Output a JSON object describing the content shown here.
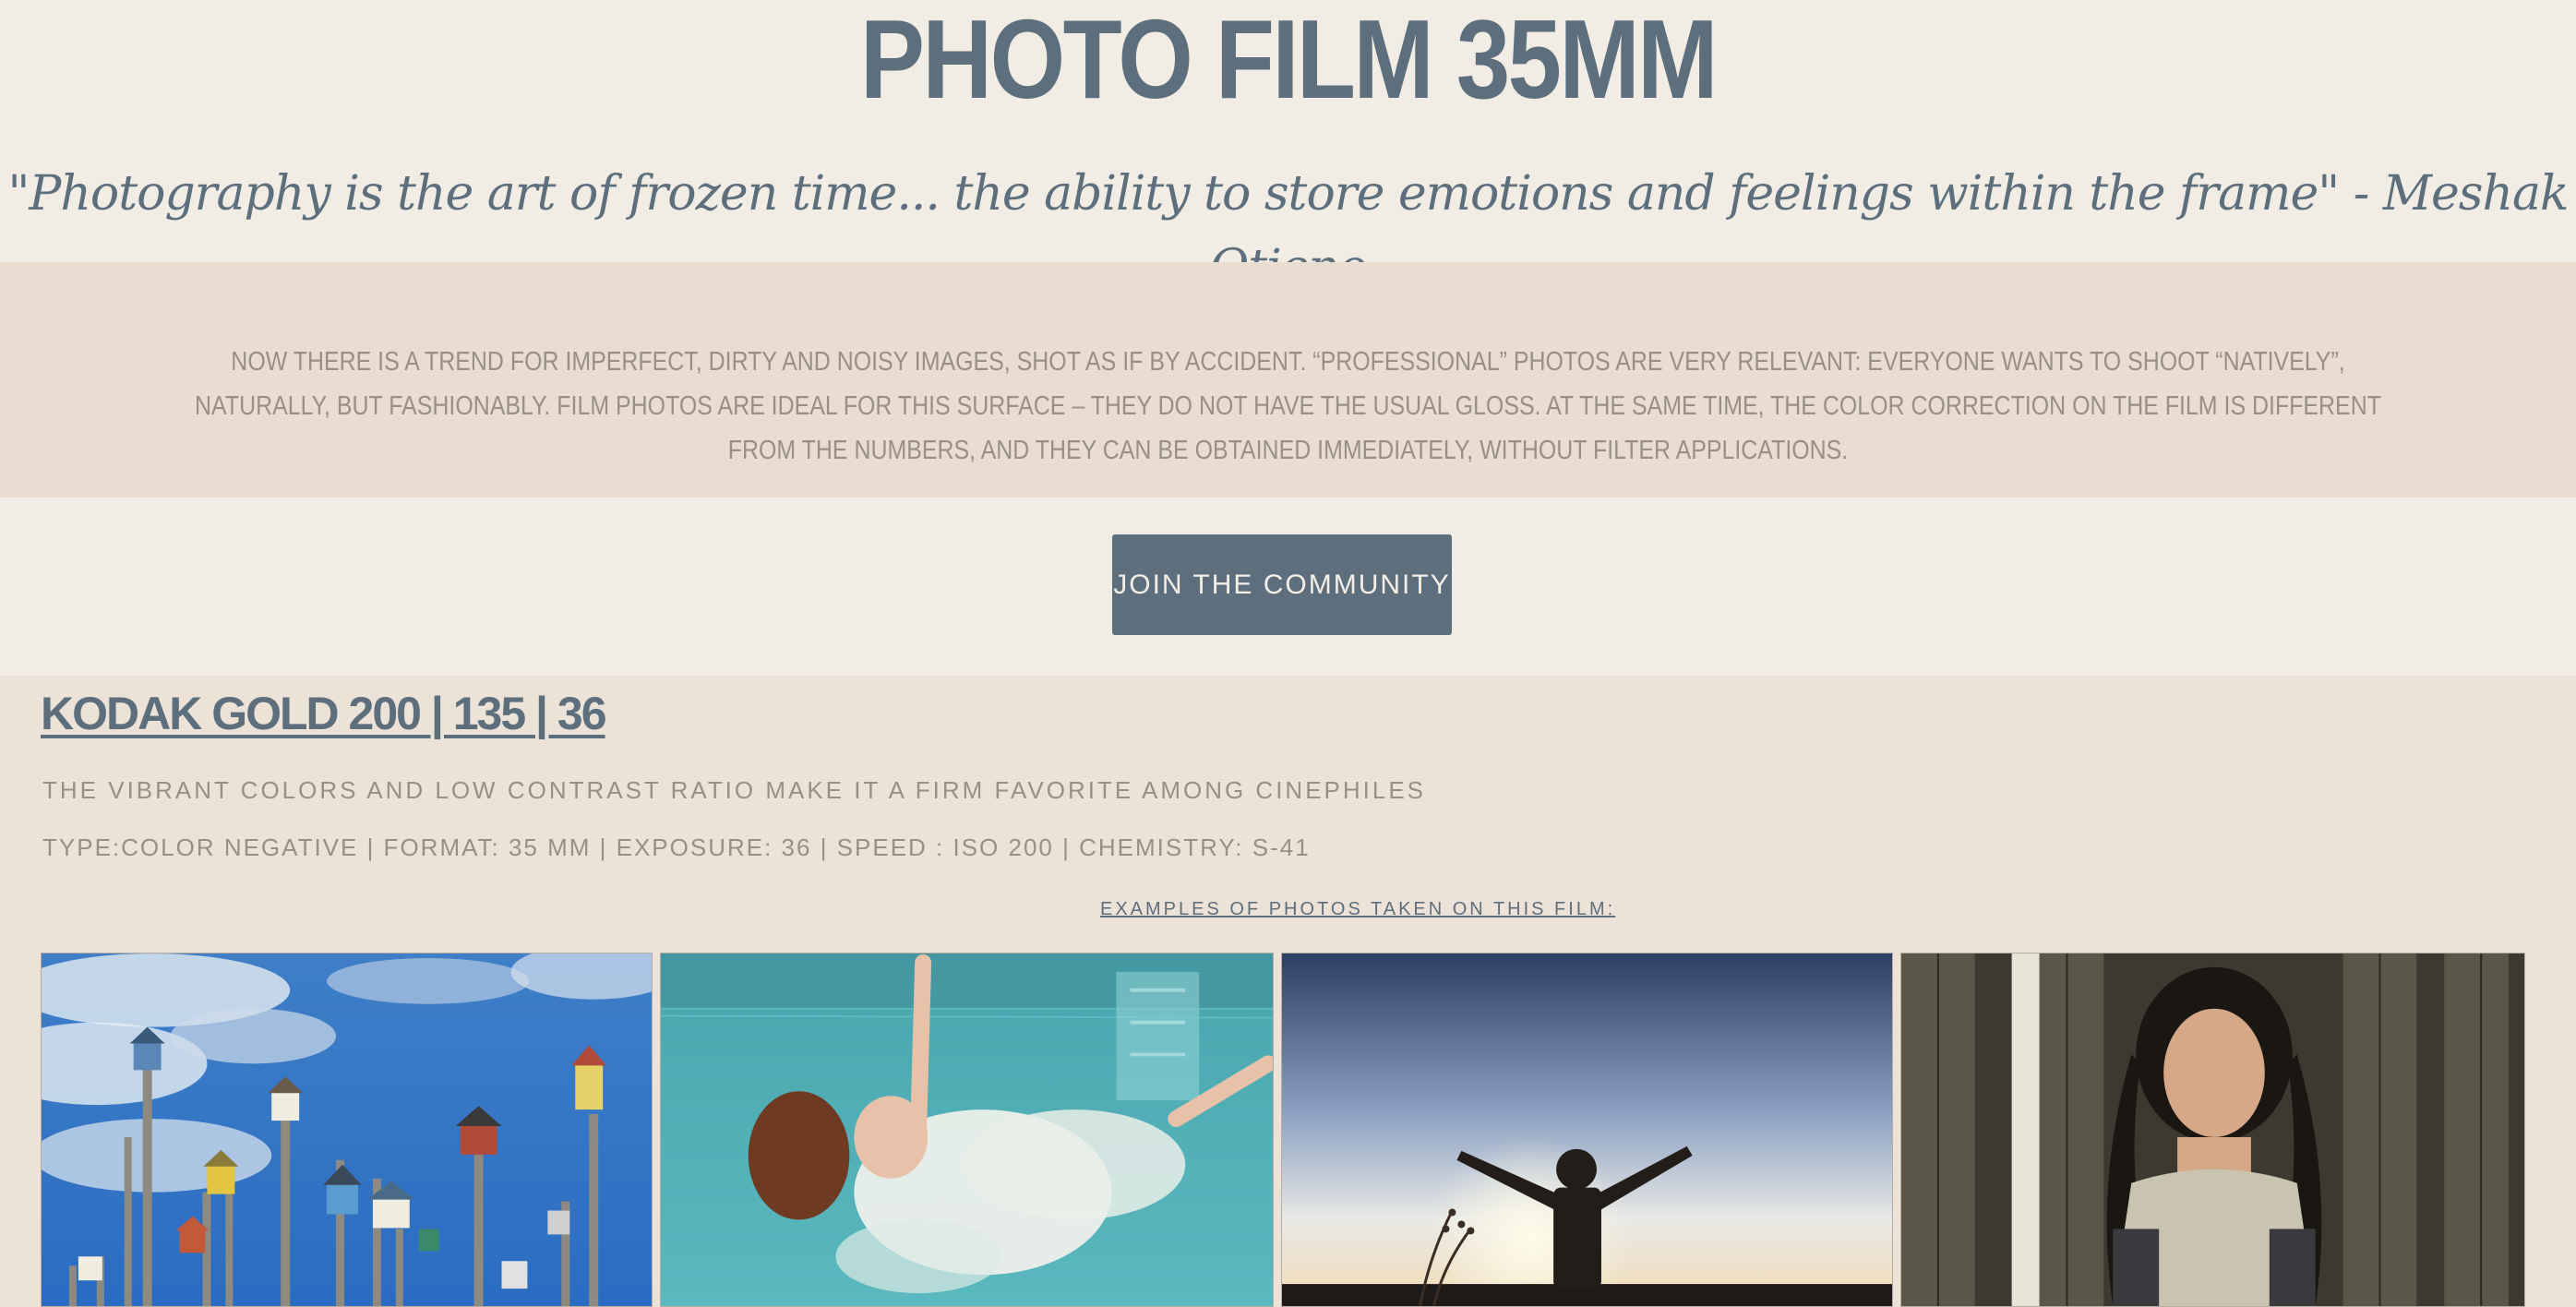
{
  "header": {
    "title": "PHOTO FILM 35MM",
    "quote": "\"Photography is the art of frozen time... the ability to store emotions and feelings within the frame\" - Meshak Otieno"
  },
  "intro": {
    "text": "Now there is a trend for imperfect, dirty and noisy images, shot as if by accident. “Professional” photos are very relevant: everyone wants to shoot “natively”, naturally, but fashionably. Film photos are ideal for this surface – they do not have the usual gloss. At the same time, the color correction on the film is different from the numbers, and they can be obtained immediately, without filter applications."
  },
  "cta": {
    "label": "JOIN THE COMMUNITY"
  },
  "film": {
    "title": "KODAK GOLD 200 | 135 | 36",
    "description": "THE VIBRANT COLORS AND LOW CONTRAST RATIO MAKE IT A FIRM FAVORITE AMONG CINEPHILES",
    "specs": "TYPE:COLOR NEGATIVE | FORMAT: 35 MM | EXPOSURE: 36 | SPEED : ISO 200 | CHEMISTRY: S-41",
    "examples_label": "EXAMPLES OF PHOTOS TAKEN ON THIS FILM:",
    "photos": [
      {
        "subject": "birdhouses-on-poles"
      },
      {
        "subject": "girl-underwater-in-pool"
      },
      {
        "subject": "child-silhouette-sunset"
      },
      {
        "subject": "girl-portrait-wooden-fence"
      }
    ]
  },
  "colors": {
    "accent": "#5d6e7c",
    "background": "#f1ede5",
    "band": "#e9ddd0",
    "muted_text": "#9a8f84"
  }
}
